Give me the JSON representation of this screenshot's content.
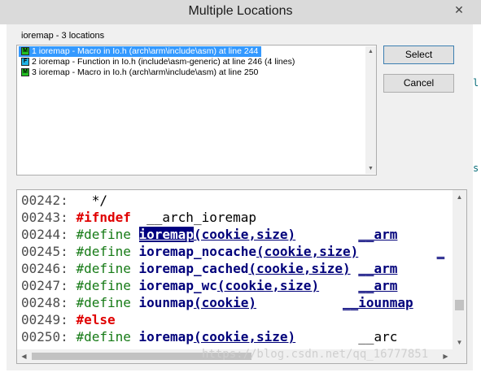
{
  "window": {
    "title": "Multiple Locations",
    "close_glyph": "✕"
  },
  "locations_label": "ioremap - 3 locations",
  "list": {
    "items": [
      {
        "icon": "M",
        "icon_color": "#22c022",
        "text": "1 ioremap - Macro in Io.h (arch\\arm\\include\\asm) at line 244",
        "selected": true
      },
      {
        "icon": "F",
        "icon_color": "#22b4e6",
        "text": "2 ioremap - Function in Io.h (include\\asm-generic) at line 246 (4 lines)",
        "selected": false
      },
      {
        "icon": "M",
        "icon_color": "#22c022",
        "text": "3 ioremap - Macro in Io.h (arch\\arm\\include\\asm) at line 250",
        "selected": false
      }
    ]
  },
  "buttons": {
    "select": "Select",
    "cancel": "Cancel"
  },
  "code": {
    "lines": [
      {
        "num": "00242:",
        "kw": "",
        "name": "",
        "args": "",
        "tail": "",
        "text": " */"
      },
      {
        "num": "00243:",
        "kw": "#ifndef",
        "name": "",
        "args": "",
        "tail": "",
        "text": "__arch_ioremap"
      },
      {
        "num": "00244:",
        "kw": "#define",
        "name": "ioremap",
        "args": "(cookie,size)",
        "tail": "__arm"
      },
      {
        "num": "00245:",
        "kw": "#define",
        "name": "ioremap_nocache",
        "args": "(cookie,size)",
        "tail": "_"
      },
      {
        "num": "00246:",
        "kw": "#define",
        "name": "ioremap_cached",
        "args": "(cookie,size)",
        "tail": "__arm"
      },
      {
        "num": "00247:",
        "kw": "#define",
        "name": "ioremap_wc",
        "args": "(cookie,size)",
        "tail": "__arm"
      },
      {
        "num": "00248:",
        "kw": "#define",
        "name": "iounmap",
        "args": "(cookie)",
        "tail": "__iounmap"
      },
      {
        "num": "00249:",
        "kw": "#else",
        "name": "",
        "args": "",
        "tail": "",
        "text": ""
      },
      {
        "num": "00250:",
        "kw": "#define",
        "name": "ioremap",
        "args": "(cookie,size)",
        "tail": "__arc"
      }
    ]
  },
  "background_fragments": [
    "l",
    "s"
  ],
  "watermark": "https://blog.csdn.net/qq_16777851",
  "colors": {
    "selection": "#3399ff",
    "highlight": "#000080",
    "keyword_red": "#e00000",
    "keyword_green": "#157a15"
  }
}
